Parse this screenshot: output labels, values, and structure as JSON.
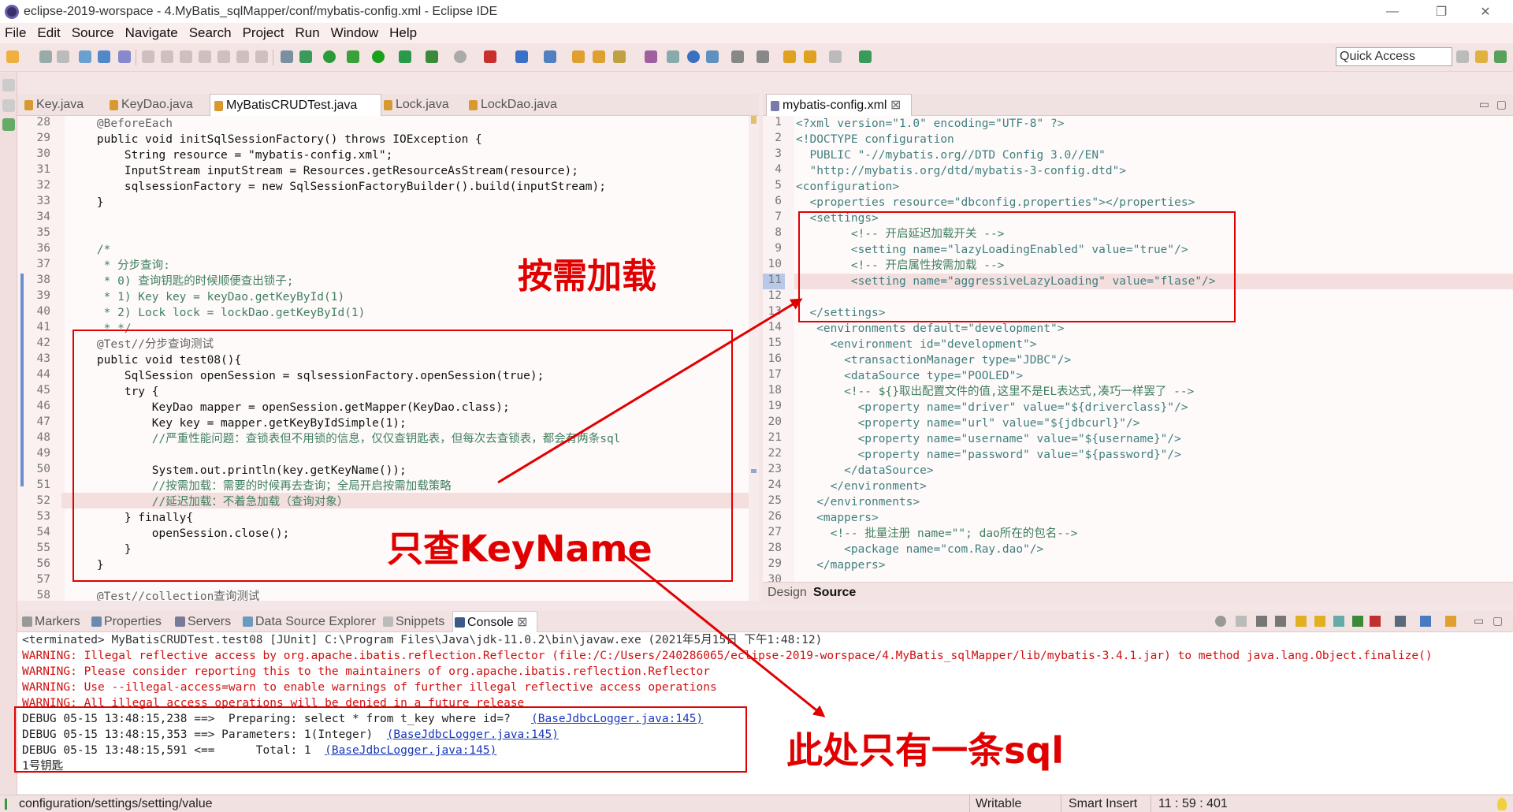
{
  "window": {
    "title": "eclipse-2019-worspace - 4.MyBatis_sqlMapper/conf/mybatis-config.xml - Eclipse IDE",
    "min": "—",
    "max": "❐",
    "close": "✕"
  },
  "menu": [
    "File",
    "Edit",
    "Source",
    "Navigate",
    "Search",
    "Project",
    "Run",
    "Window",
    "Help"
  ],
  "quick_access": "Quick Access",
  "left_tabs": [
    "Key.java",
    "KeyDao.java",
    "MyBatisCRUDTest.java",
    "Lock.java",
    "LockDao.java"
  ],
  "right_tab": "mybatis-config.xml",
  "java_line_numbers": [
    "28",
    "29",
    "30",
    "31",
    "32",
    "33",
    "34",
    "35",
    "36",
    "37",
    "38",
    "39",
    "40",
    "41",
    "42",
    "43",
    "44",
    "45",
    "46",
    "47",
    "48",
    "49",
    "50",
    "51",
    "52",
    "53",
    "54",
    "55",
    "56",
    "57",
    "58"
  ],
  "xml_line_numbers": [
    "1",
    "2",
    "3",
    "4",
    "5",
    "6",
    "7",
    "8",
    "9",
    "10",
    "11",
    "12",
    "13",
    "14",
    "15",
    "16",
    "17",
    "18",
    "19",
    "20",
    "21",
    "22",
    "23",
    "24",
    "25",
    "26",
    "27",
    "28",
    "29",
    "30"
  ],
  "java_lines": [
    "    @BeforeEach",
    "    public void initSqlSessionFactory() throws IOException {",
    "        String resource = \"mybatis-config.xml\";",
    "        InputStream inputStream = Resources.getResourceAsStream(resource);",
    "        sqlsessionFactory = new SqlSessionFactoryBuilder().build(inputStream);",
    "    }",
    "",
    "",
    "    /*",
    "     * 分步查询:",
    "     * 0) 查询钥匙的时候顺便查出锁子;",
    "     * 1) Key key = keyDao.getKeyById(1)",
    "     * 2) Lock lock = lockDao.getKeyById(1)",
    "     * */",
    "    @Test//分步查询测试",
    "    public void test08(){",
    "        SqlSession openSession = sqlsessionFactory.openSession(true);",
    "        try {",
    "            KeyDao mapper = openSession.getMapper(KeyDao.class);",
    "            Key key = mapper.getKeyByIdSimple(1);",
    "            //严重性能问题：查锁表但不用锁的信息，仅仅查钥匙表，但每次去查锁表，都会有两条sql",
    "",
    "            System.out.println(key.getKeyName());",
    "            //按需加载：需要的时候再去查询；全局开启按需加载策略",
    "            //延迟加载：不着急加载（查询对象）",
    "        } finally{",
    "            openSession.close();",
    "        }",
    "    }",
    "",
    "    @Test//collection查询测试"
  ],
  "xml_lines": [
    "<?xml version=\"1.0\" encoding=\"UTF-8\" ?>",
    "<!DOCTYPE configuration",
    "  PUBLIC \"-//mybatis.org//DTD Config 3.0//EN\"",
    "  \"http://mybatis.org/dtd/mybatis-3-config.dtd\">",
    "<configuration>",
    "  <properties resource=\"dbconfig.properties\"></properties>",
    "  <settings>",
    "        <!-- 开启延迟加载开关 -->",
    "        <setting name=\"lazyLoadingEnabled\" value=\"true\"/>",
    "        <!-- 开启属性按需加载 -->",
    "        <setting name=\"aggressiveLazyLoading\" value=\"flase\"/>",
    "",
    "  </settings>",
    "   <environments default=\"development\">",
    "     <environment id=\"development\">",
    "       <transactionManager type=\"JDBC\"/>",
    "       <dataSource type=\"POOLED\">",
    "       <!-- ${}取出配置文件的值,这里不是EL表达式,凑巧一样罢了 -->",
    "         <property name=\"driver\" value=\"${driverclass}\"/>",
    "         <property name=\"url\" value=\"${jdbcurl}\"/>",
    "         <property name=\"username\" value=\"${username}\"/>",
    "         <property name=\"password\" value=\"${password}\"/>",
    "       </dataSource>",
    "     </environment>",
    "   </environments>",
    "   <mappers>",
    "     <!-- 批量注册 name=\"\"; dao所在的包名-->",
    "       <package name=\"com.Ray.dao\"/>",
    "   </mappers>",
    ""
  ],
  "xml_bottom_tabs": [
    "Design",
    "Source"
  ],
  "console_tabs": [
    "Markers",
    "Properties",
    "Servers",
    "Data Source Explorer",
    "Snippets",
    "Console"
  ],
  "console_header": "<terminated> MyBatisCRUDTest.test08 [JUnit] C:\\Program Files\\Java\\jdk-11.0.2\\bin\\javaw.exe (2021年5月15日 下午1:48:12)",
  "console_warnings": [
    "WARNING: Illegal reflective access by org.apache.ibatis.reflection.Reflector (file:/C:/Users/240286065/eclipse-2019-worspace/4.MyBatis_sqlMapper/lib/mybatis-3.4.1.jar) to method java.lang.Object.finalize()",
    "WARNING: Please consider reporting this to the maintainers of org.apache.ibatis.reflection.Reflector",
    "WARNING: Use --illegal-access=warn to enable warnings of further illegal reflective access operations",
    "WARNING: All illegal access operations will be denied in a future release"
  ],
  "console_debug": [
    {
      "text": "DEBUG 05-15 13:48:15,238 ==>  Preparing: select * from t_key where id=?   ",
      "link": "(BaseJdbcLogger.java:145)",
      "tail": ")"
    },
    {
      "text": "DEBUG 05-15 13:48:15,353 ==> Parameters: 1(Integer)  ",
      "link": "(BaseJdbcLogger.java:145)",
      "tail": ")"
    },
    {
      "text": "DEBUG 05-15 13:48:15,591 <==      Total: 1  ",
      "link": "(BaseJdbcLogger.java:145)",
      "tail": ")"
    }
  ],
  "console_result": "1号钥匙",
  "status": {
    "path": "configuration/settings/setting/value",
    "writable": "Writable",
    "insert": "Smart Insert",
    "position": "11 : 59 : 401"
  },
  "annotations": {
    "on_demand": "按需加载",
    "only_keyname": "只查KeyName",
    "one_sql": "此处只有一条sql"
  },
  "colors": {
    "annotation_red": "#e00000",
    "keyword": "#7f0055",
    "comment": "#3f7f5f",
    "string": "#2a00ff",
    "warning": "#d01010"
  }
}
